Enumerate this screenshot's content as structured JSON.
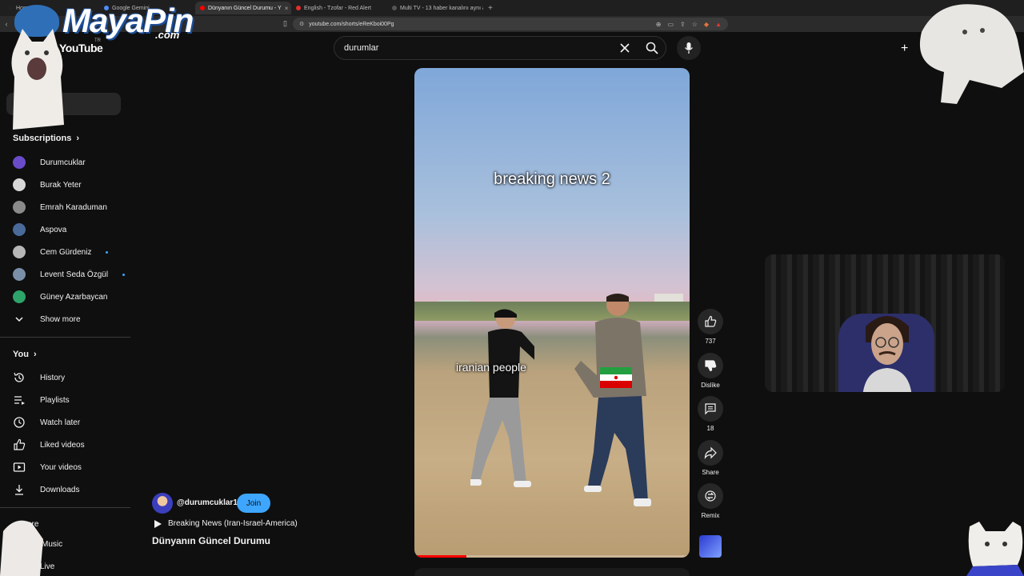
{
  "browser": {
    "tabs": [
      {
        "label": "Home / X",
        "active": false,
        "fav": "#222"
      },
      {
        "label": "Google Gemini",
        "active": false,
        "fav": "#4f8cff"
      },
      {
        "label": "Dünyanın Güncel Durumu - Y",
        "active": true,
        "fav": "#ff0000"
      },
      {
        "label": "English - Tzofar - Red Alert",
        "active": false,
        "fav": "#e0302f"
      },
      {
        "label": "Multi TV - 13 haber kanalını aynı and",
        "active": false,
        "fav": "#555"
      }
    ],
    "url": "youtube.com/shorts/eReKboi00Pg"
  },
  "watermark": {
    "brand": "MayaPin",
    "suffix": ".com"
  },
  "youtube": {
    "logo": "YouTube",
    "country": "TR",
    "search": {
      "value": "durumlar"
    },
    "sidebar": {
      "subscriptions_label": "Subscriptions",
      "subscriptions": [
        {
          "name": "Durumcuklar",
          "color": "#6a4cc9",
          "dot": false
        },
        {
          "name": "Burak Yeter",
          "color": "#d8d8d8",
          "dot": false
        },
        {
          "name": "Emrah Karaduman",
          "color": "#8a8a8a",
          "dot": false
        },
        {
          "name": "Aspova",
          "color": "#4a6a9a",
          "dot": false
        },
        {
          "name": "Cem Gürdeniz",
          "color": "#b6b6b6",
          "dot": true
        },
        {
          "name": "Levent Seda Özgül",
          "color": "#7a8fa8",
          "dot": true
        },
        {
          "name": "Güney Azarbaycan",
          "color": "#2ea36a",
          "dot": false
        }
      ],
      "show_more": "Show more",
      "you_label": "You",
      "you_items": [
        {
          "label": "History",
          "icon": "history-icon"
        },
        {
          "label": "Playlists",
          "icon": "playlists-icon"
        },
        {
          "label": "Watch later",
          "icon": "watch-later-icon"
        },
        {
          "label": "Liked videos",
          "icon": "liked-videos-icon"
        },
        {
          "label": "Your videos",
          "icon": "your-videos-icon"
        },
        {
          "label": "Downloads",
          "icon": "downloads-icon"
        }
      ],
      "explore_partial": "ore",
      "explore_items": [
        "Music",
        "Live"
      ]
    },
    "short": {
      "caption_top": "breaking news 2",
      "caption_person": "iranian people",
      "progress": 0.19,
      "actions": {
        "like_count": "737",
        "dislike_label": "Dislike",
        "comment_count": "18",
        "share_label": "Share",
        "remix_label": "Remix"
      },
      "channel_handle": "@durumcuklar1",
      "join_label": "Join",
      "playlist_label": "Breaking News (Iran-Israel-America)",
      "title": "Dünyanın Güncel Durumu"
    }
  }
}
